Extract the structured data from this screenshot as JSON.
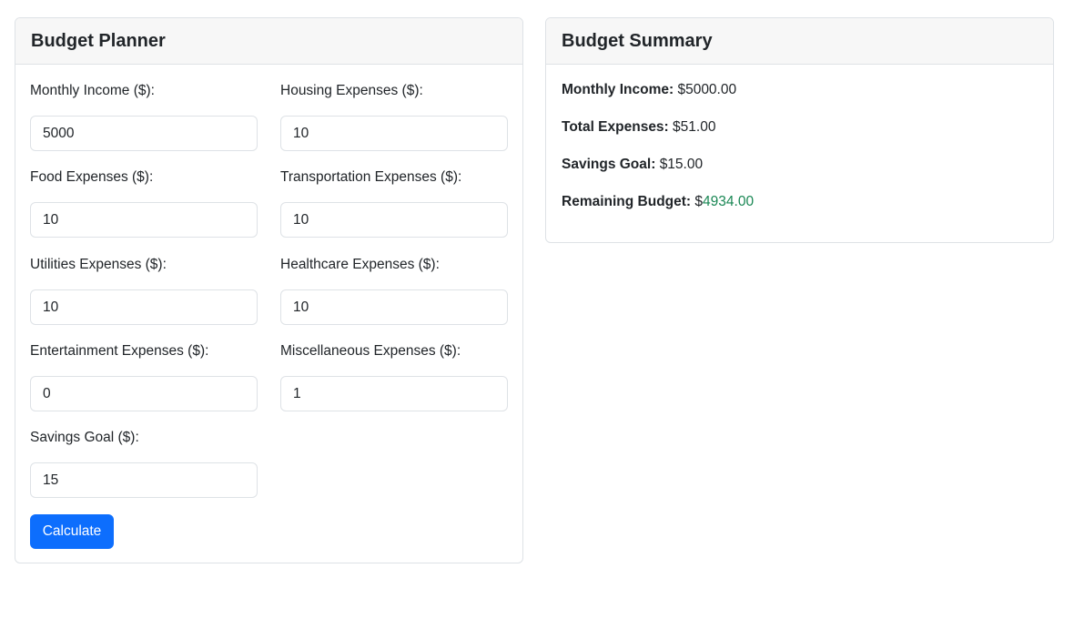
{
  "planner": {
    "title": "Budget Planner",
    "fields": {
      "income": {
        "label": "Monthly Income ($):",
        "value": "5000"
      },
      "housing": {
        "label": "Housing Expenses ($):",
        "value": "10"
      },
      "food": {
        "label": "Food Expenses ($):",
        "value": "10"
      },
      "transportation": {
        "label": "Transportation Expenses ($):",
        "value": "10"
      },
      "utilities": {
        "label": "Utilities Expenses ($):",
        "value": "10"
      },
      "healthcare": {
        "label": "Healthcare Expenses ($):",
        "value": "10"
      },
      "entertainment": {
        "label": "Entertainment Expenses ($):",
        "value": "0"
      },
      "miscellaneous": {
        "label": "Miscellaneous Expenses ($):",
        "value": "1"
      },
      "savings": {
        "label": "Savings Goal ($):",
        "value": "15"
      }
    },
    "calculate_label": "Calculate"
  },
  "summary": {
    "title": "Budget Summary",
    "income_label": "Monthly Income:",
    "income_value": "$5000.00",
    "expenses_label": "Total Expenses:",
    "expenses_value": "$51.00",
    "savings_label": "Savings Goal:",
    "savings_value": "$15.00",
    "remaining_label": "Remaining Budget:",
    "remaining_currency": "$",
    "remaining_value": "4934.00"
  },
  "colors": {
    "primary": "#0d6efd",
    "success": "#198754",
    "header_bg": "#f7f7f7",
    "border": "#dee2e6"
  }
}
